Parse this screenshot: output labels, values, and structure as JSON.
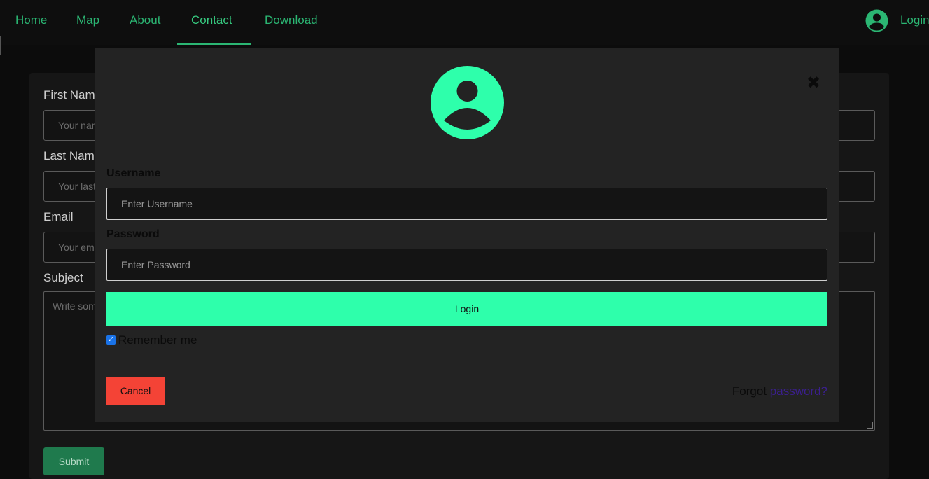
{
  "nav": {
    "items": [
      {
        "label": "Home"
      },
      {
        "label": "Map"
      },
      {
        "label": "About"
      },
      {
        "label": "Contact"
      },
      {
        "label": "Download"
      }
    ],
    "active": "Contact",
    "login_label": "Login",
    "avatar_icon": "user-circle-icon"
  },
  "contact_form": {
    "first_name": {
      "label": "First Name",
      "placeholder": "Your name.."
    },
    "last_name": {
      "label": "Last Name",
      "placeholder": "Your last name.."
    },
    "email": {
      "label": "Email",
      "placeholder": "Your email.."
    },
    "subject": {
      "label": "Subject",
      "placeholder": "Write something.."
    },
    "submit_label": "Submit"
  },
  "login_modal": {
    "avatar_icon": "user-circle-icon",
    "close_icon": "close-icon",
    "username_label": "Username",
    "username_placeholder": "Enter Username",
    "password_label": "Password",
    "password_placeholder": "Enter Password",
    "login_button": "Login",
    "remember_label": "Remember me",
    "remember_checked": true,
    "cancel_button": "Cancel",
    "forgot_text": "Forgot ",
    "forgot_link": "password?"
  },
  "colors": {
    "accent": "#2effab",
    "nav_green": "#2bb673",
    "cancel_red": "#f44336",
    "link_purple": "#3b1f8f"
  }
}
